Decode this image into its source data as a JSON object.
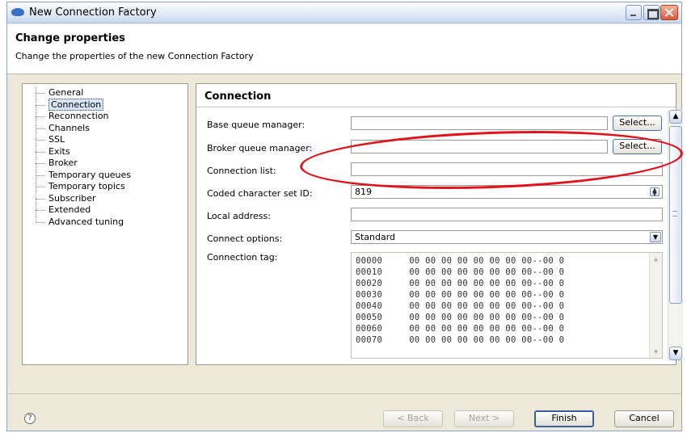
{
  "window": {
    "title": "New Connection Factory"
  },
  "header": {
    "title": "Change properties",
    "subtitle": "Change the properties of the new Connection Factory"
  },
  "nav": {
    "items": [
      {
        "label": "General",
        "selected": false
      },
      {
        "label": "Connection",
        "selected": true
      },
      {
        "label": "Reconnection",
        "selected": false
      },
      {
        "label": "Channels",
        "selected": false
      },
      {
        "label": "SSL",
        "selected": false
      },
      {
        "label": "Exits",
        "selected": false
      },
      {
        "label": "Broker",
        "selected": false
      },
      {
        "label": "Temporary queues",
        "selected": false
      },
      {
        "label": "Temporary topics",
        "selected": false
      },
      {
        "label": "Subscriber",
        "selected": false
      },
      {
        "label": "Extended",
        "selected": false
      },
      {
        "label": "Advanced tuning",
        "selected": false
      }
    ]
  },
  "panel": {
    "title": "Connection",
    "base_qm": {
      "label": "Base queue manager:",
      "value": "",
      "button": "Select..."
    },
    "broker_qm": {
      "label": "Broker queue manager:",
      "value": "",
      "button": "Select..."
    },
    "conn_list": {
      "label": "Connection list:",
      "value": ""
    },
    "ccsid": {
      "label": "Coded character set ID:",
      "value": "819"
    },
    "local_addr": {
      "label": "Local address:",
      "value": ""
    },
    "connect_options": {
      "label": "Connect options:",
      "value": "Standard"
    },
    "conn_tag": {
      "label": "Connection tag:",
      "rows": [
        "00000     00 00 00 00 00 00 00 00--00 0",
        "00010     00 00 00 00 00 00 00 00--00 0",
        "00020     00 00 00 00 00 00 00 00--00 0",
        "00030     00 00 00 00 00 00 00 00--00 0",
        "00040     00 00 00 00 00 00 00 00--00 0",
        "00050     00 00 00 00 00 00 00 00--00 0",
        "00060     00 00 00 00 00 00 00 00--00 0",
        "00070     00 00 00 00 00 00 00 00--00 0"
      ]
    }
  },
  "footer": {
    "back": "< Back",
    "next": "Next >",
    "finish": "Finish",
    "cancel": "Cancel",
    "help_icon": "question-circle-icon"
  },
  "colors": {
    "annotation": "#e2121a",
    "accent": "#3a5fa8"
  }
}
